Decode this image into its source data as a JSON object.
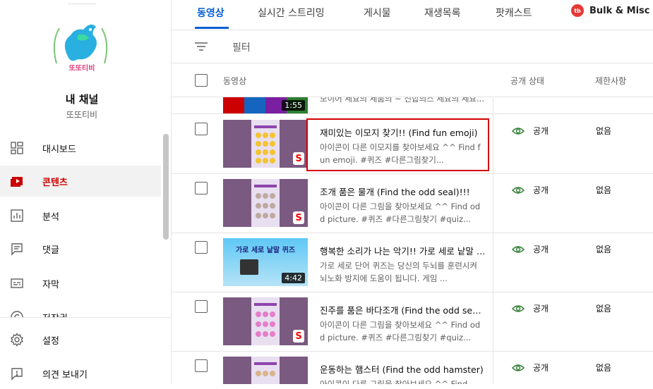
{
  "channel": {
    "logo_text": "또또티비",
    "title": "내 채널",
    "name": "또또티비"
  },
  "nav": [
    {
      "label": "대시보드",
      "icon": "dashboard-icon",
      "active": false
    },
    {
      "label": "콘텐츠",
      "icon": "content-icon",
      "active": true
    },
    {
      "label": "분석",
      "icon": "analytics-icon",
      "active": false
    },
    {
      "label": "댓글",
      "icon": "comments-icon",
      "active": false
    },
    {
      "label": "자막",
      "icon": "subtitles-icon",
      "active": false
    },
    {
      "label": "저작권",
      "icon": "copyright-icon",
      "active": false
    }
  ],
  "nav_bottom": [
    {
      "label": "설정",
      "icon": "gear-icon"
    },
    {
      "label": "의견 보내기",
      "icon": "feedback-icon"
    }
  ],
  "tabs": [
    "동영상",
    "실시간 스트리밍",
    "게시물",
    "재생목록",
    "팟캐스트"
  ],
  "bulk_button": {
    "label": "Bulk & Misc T",
    "logo": "tb"
  },
  "filter": {
    "label": "필터"
  },
  "table_headers": {
    "video": "동영상",
    "visibility": "공개 상태",
    "restrictions": "제한사항"
  },
  "partial_row": {
    "title": "모이어 세요의 세품의 ~ 신합의스 세요의 세요...",
    "duration": "1:55"
  },
  "rows": [
    {
      "title": "재미있는 이모지 찾기!! (Find fun emoji)",
      "desc": "아이콘이 다른 이모지를 찾아보세요 ^^ Find fun emoji. #퀴즈 #다른그림찾기...",
      "visibility": "공개",
      "restrictions": "없음",
      "thumb": "shorts-emoji"
    },
    {
      "title": "조개 품은 물개 (Find the odd seal)!!!",
      "desc": "아이콘이 다른 그림을 찾아보세요 ^^ Find odd picture. #퀴즈 #다른그림찾기 #quiz...",
      "visibility": "공개",
      "restrictions": "없음",
      "thumb": "shorts-seal"
    },
    {
      "title": "행복한 소리가 나는 악기!! 가로 세로 낱말 퀴즈",
      "desc": "가로 세로 단어 퀴즈는 당신의 두뇌를 훈련시켜 뇌노화 방지에 도움이 됩니다. 게임 ...",
      "visibility": "공개",
      "restrictions": "없음",
      "thumb": "crossword",
      "thumb_text": "가로 세로 낱말 퀴즈",
      "duration": "4:42"
    },
    {
      "title": "진주를 품은 바다조개 (Find the odd seashell)",
      "desc": "아이콘이 다른 그림을 찾아보세요 ^^ Find odd picture. #퀴즈 #다른그림찾기 #quiz...",
      "visibility": "공개",
      "restrictions": "없음",
      "thumb": "shorts-shell"
    },
    {
      "title": "운동하는 햄스터 (Find the odd hamster)",
      "desc": "아이콘이 다른 그림을 찾아보세요 ^^ Find",
      "visibility": "공개",
      "restrictions": "없음",
      "thumb": "shorts-hamster"
    }
  ],
  "colors": {
    "accent": "#065fd4",
    "active_nav": "#cc0000",
    "highlight_box": "#d40000",
    "shorts": "#ff0000"
  }
}
